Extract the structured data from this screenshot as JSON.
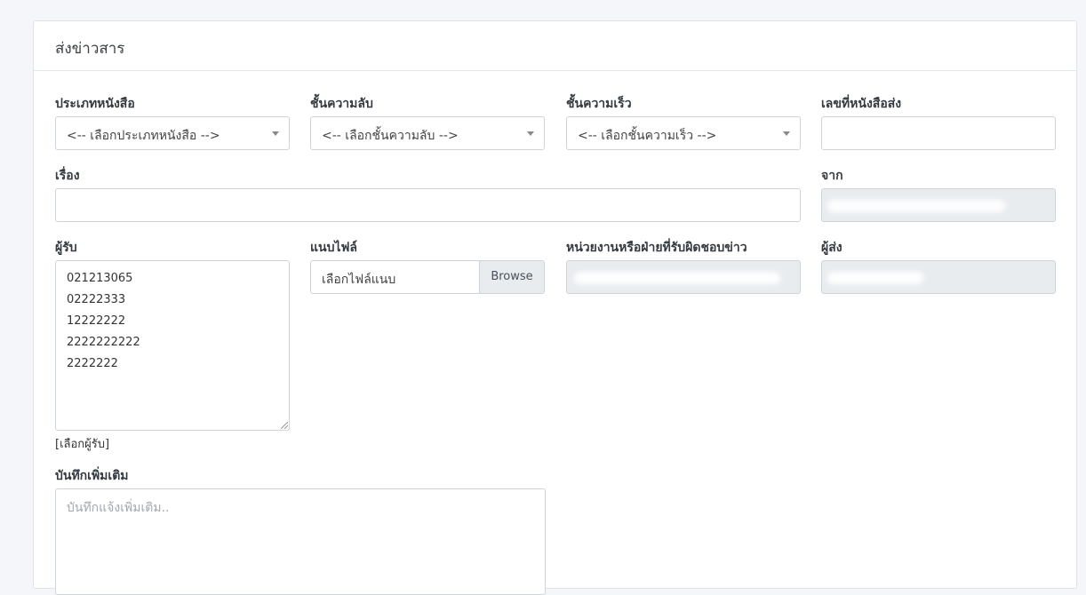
{
  "card": {
    "title": "ส่งข่าวสาร"
  },
  "fields": {
    "doc_type": {
      "label": "ประเภทหนังสือ",
      "selected": "<-- เลือกประเภทหนังสือ -->"
    },
    "secrecy": {
      "label": "ชั้นความลับ",
      "selected": "<-- เลือกชั้นความลับ -->"
    },
    "urgency": {
      "label": "ชั้นความเร็ว",
      "selected": "<-- เลือกชั้นความเร็ว -->"
    },
    "doc_number": {
      "label": "เลขที่หนังสือส่ง",
      "value": ""
    },
    "subject": {
      "label": "เรื่อง",
      "value": ""
    },
    "from": {
      "label": "จาก"
    },
    "recipients": {
      "label": "ผู้รับ",
      "items": [
        "021213065",
        "02222333",
        "12222222",
        "2222222222",
        "2222222"
      ],
      "select_link": "[เลือกผู้รับ]"
    },
    "attachment": {
      "label": "แนบไฟล์",
      "placeholder": "เลือกไฟล์แนบ",
      "browse_label": "Browse"
    },
    "responsible_unit": {
      "label": "หน่วยงานหรือฝ่ายที่รับผิดชอบข่าว"
    },
    "sender": {
      "label": "ผู้ส่ง"
    },
    "note": {
      "label": "บันทึกเพิ่มเติม",
      "placeholder": "บันทึกแจ้งเพิ่มเติม.."
    }
  }
}
